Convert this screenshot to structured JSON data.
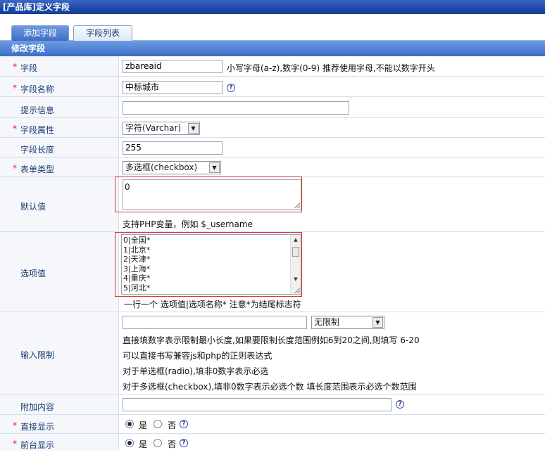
{
  "window_title": "[产品库]定义字段",
  "tabs": [
    {
      "label": "添加字段"
    },
    {
      "label": "字段列表"
    }
  ],
  "section_title": "修改字段",
  "required_mark": "*",
  "fields": {
    "field": {
      "label": "字段",
      "value": "zbareaid",
      "hint": "小写字母(a-z),数字(0-9) 推荐使用字母,不能以数字开头"
    },
    "field_name": {
      "label": "字段名称",
      "value": "中标城市"
    },
    "tip": {
      "label": "提示信息",
      "value": ""
    },
    "attr": {
      "label": "字段属性",
      "selected": "字符(Varchar)"
    },
    "length": {
      "label": "字段长度",
      "value": "255"
    },
    "form_type": {
      "label": "表单类型",
      "selected": "多选框(checkbox)"
    },
    "default": {
      "label": "默认值",
      "value": "0",
      "hint": "支持PHP变量，例如 $_username"
    },
    "options": {
      "label": "选项值",
      "items": [
        "0|全国*",
        "1|北京*",
        "2|天津*",
        "3|上海*",
        "4|重庆*",
        "5|河北*"
      ],
      "hint": "一行一个 选项值|选项名称* 注意*为结尾标志符"
    },
    "limit": {
      "label": "输入限制",
      "value": "",
      "selected": "无限制",
      "hints": [
        "直接填数字表示限制最小长度,如果要限制长度范围例如6到20之间,则填写 6-20",
        "可以直接书写兼容js和php的正则表达式",
        "对于单选框(radio),填非0数字表示必选",
        "对于多选框(checkbox),填非0数字表示必选个数 填长度范围表示必选个数范围"
      ]
    },
    "extra": {
      "label": "附加内容",
      "value": ""
    },
    "show_direct": {
      "label": "直接显示",
      "yes": "是",
      "no": "否",
      "selected": "yes"
    },
    "show_front": {
      "label": "前台显示",
      "yes": "是",
      "no": "否",
      "selected": "yes"
    }
  },
  "icons": {
    "help": "help-icon",
    "dropdown": "dropdown-arrow-icon",
    "scroll_up": "scroll-up-icon",
    "scroll_down": "scroll-down-icon"
  },
  "colors": {
    "accent": "#2f5fb8",
    "required": "#e0201a",
    "highlight_box": "#d9342b"
  }
}
